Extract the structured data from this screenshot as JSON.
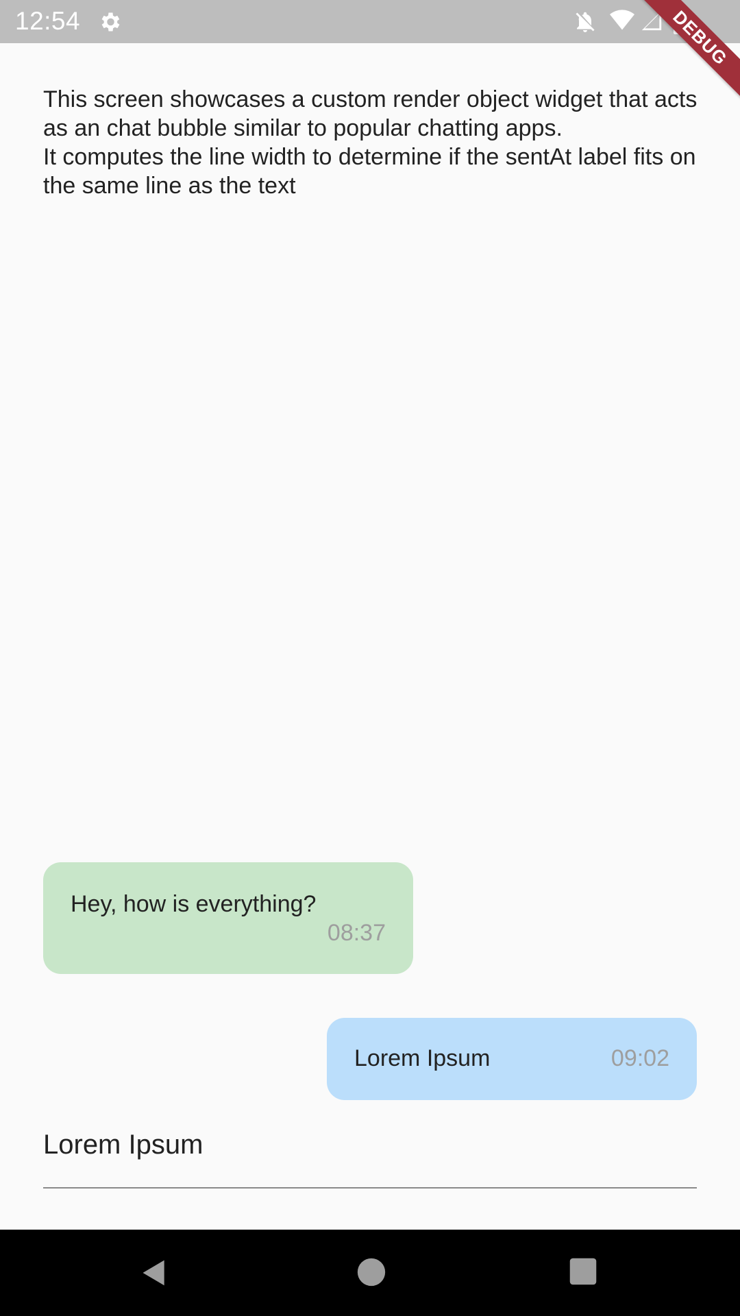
{
  "status_bar": {
    "time": "12:54",
    "icons": [
      "gear-icon",
      "notifications-off-icon",
      "wifi-icon",
      "signal-icon",
      "battery-icon"
    ],
    "background": "#bdbdbd"
  },
  "debug_banner": {
    "label": "DEBUG",
    "color": "#a0303a"
  },
  "description": "This screen showcases a custom render object widget that acts as an chat bubble similar to popular chatting apps.\nIt computes the line width to determine if the sentAt label fits on the same line as the text",
  "messages": [
    {
      "text": "Hey, how is everything?",
      "time": "08:37",
      "direction": "incoming",
      "color": "#c8e6c9"
    },
    {
      "text": "Lorem Ipsum",
      "time": "09:02",
      "direction": "outgoing",
      "color": "#bbdefb"
    }
  ],
  "input": {
    "value": "Lorem Ipsum"
  },
  "nav_bar": {
    "buttons": [
      "back-icon",
      "home-icon",
      "recents-icon"
    ]
  }
}
